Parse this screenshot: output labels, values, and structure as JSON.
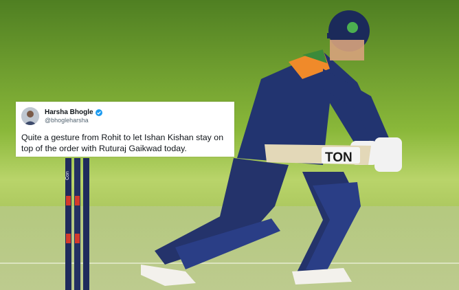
{
  "scene": {
    "description_icon": "cricket-batsman-photo",
    "bat_logo": "TON",
    "stump_brand": "Con"
  },
  "tweet": {
    "display_name": "Harsha Bhogle",
    "handle": "@bhogleharsha",
    "verified": true,
    "text": "Quite a gesture from Rohit to let Ishan Kishan stay on\ntop of the order with Ruturaj Gaikwad today.",
    "accent_color": "#1d9bf0"
  }
}
